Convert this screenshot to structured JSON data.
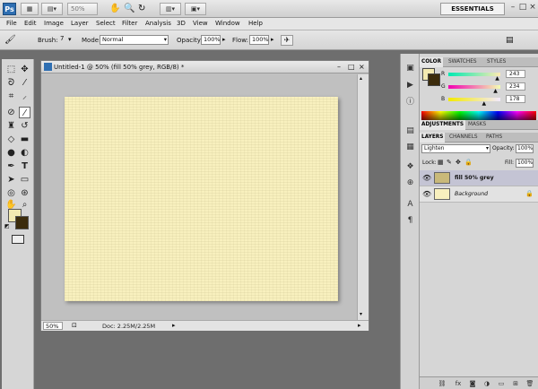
{
  "app": {
    "logo": "Ps",
    "zoom_display": "50%",
    "workspace": "ESSENTIALS",
    "window_controls": [
      "–",
      "□",
      "×"
    ]
  },
  "menu": [
    "File",
    "Edit",
    "Image",
    "Layer",
    "Select",
    "Filter",
    "Analysis",
    "3D",
    "View",
    "Window",
    "Help"
  ],
  "options_bar": {
    "brush_label": "Brush:",
    "brush_size": "7",
    "mode_label": "Mode:",
    "mode_value": "Normal",
    "opacity_label": "Opacity:",
    "opacity_value": "100%",
    "flow_label": "Flow:",
    "flow_value": "100%"
  },
  "document": {
    "title": "Untitled-1 @ 50% (fill 50% grey, RGB/8) *",
    "zoom": "50%",
    "doc_size": "Doc: 2.25M/2.25M"
  },
  "color_panel": {
    "tabs": [
      "COLOR",
      "SWATCHES",
      "STYLES"
    ],
    "active_tab": "COLOR",
    "r_label": "R",
    "g_label": "G",
    "b_label": "B",
    "r_value": "243",
    "g_value": "234",
    "b_value": "178",
    "r_fraction": 0.953,
    "g_fraction": 0.918,
    "b_fraction": 0.698,
    "foreground_color": "#f3eab2",
    "background_color": "#3c2c0c"
  },
  "adjustments_panel": {
    "tabs": [
      "ADJUSTMENTS",
      "MASKS"
    ],
    "active_tab": "ADJUSTMENTS"
  },
  "layers_panel": {
    "tabs": [
      "LAYERS",
      "CHANNELS",
      "PATHS"
    ],
    "active_tab": "LAYERS",
    "blend_mode": "Lighten",
    "opacity_label": "Opacity:",
    "opacity_value": "100%",
    "lock_label": "Lock:",
    "fill_label": "Fill:",
    "fill_value": "100%",
    "layers": [
      {
        "name": "fill 50% grey",
        "selected": true
      },
      {
        "name": "Background",
        "selected": false
      }
    ]
  }
}
